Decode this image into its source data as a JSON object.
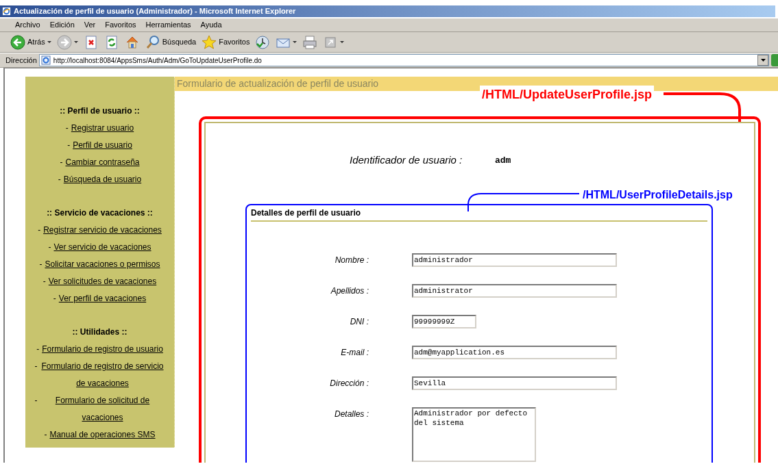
{
  "window": {
    "title": "Actualización de perfil de usuario (Administrador) - Microsoft Internet Explorer"
  },
  "menu": [
    "Archivo",
    "Edición",
    "Ver",
    "Favoritos",
    "Herramientas",
    "Ayuda"
  ],
  "toolbar": [
    {
      "kind": "back",
      "label": "Atrás"
    },
    {
      "kind": "forward"
    },
    {
      "kind": "stop"
    },
    {
      "kind": "refresh"
    },
    {
      "kind": "home"
    },
    {
      "kind": "search",
      "label": "Búsqueda"
    },
    {
      "kind": "favorites",
      "label": "Favoritos"
    },
    {
      "kind": "history"
    },
    {
      "kind": "mail"
    },
    {
      "kind": "print"
    },
    {
      "kind": "edit"
    }
  ],
  "address_bar": {
    "label": "Dirección",
    "url": "http://localhost:8084/AppsSms/Auth/Adm/GoToUpdateUserProfile.do"
  },
  "sidebar": {
    "sections": [
      {
        "heading": ":: Perfil de usuario ::",
        "links": [
          {
            "marker": "-",
            "label": "Registrar usuario"
          },
          {
            "marker": "-",
            "label": "Perfil de usuario"
          },
          {
            "marker": "-",
            "label": "Cambiar contraseña"
          },
          {
            "marker": "-",
            "label": "Búsqueda de usuario"
          }
        ]
      },
      {
        "heading": ":: Servicio de vacaciones ::",
        "links": [
          {
            "marker": "-",
            "label": "Registrar servicio de vacaciones"
          },
          {
            "marker": "-",
            "label": "Ver servicio de vacaciones"
          },
          {
            "marker": "-",
            "label": "Solicitar vacaciones o permisos"
          },
          {
            "marker": "-",
            "label": "Ver solicitudes de vacaciones"
          },
          {
            "marker": "-",
            "label": "Ver perfil de vacaciones"
          }
        ]
      },
      {
        "heading": ":: Utilidades ::",
        "links": [
          {
            "marker": "-",
            "label": "Formulario de registro de usuario"
          },
          {
            "marker": "-",
            "label": "Formulario de registro de servicio de vacaciones"
          },
          {
            "marker": "-",
            "label": "Formulario de solicitud de vacaciones"
          },
          {
            "marker": "-",
            "label": "Manual de operaciones SMS"
          }
        ]
      }
    ]
  },
  "page_header": "Formulario de actualización de perfil de usuario",
  "annotations": [
    "/HTML/UpdateUserProfile.jsp",
    "/HTML/UserProfileDetails.jsp"
  ],
  "user_id": {
    "label": "Identificador de usuario :",
    "value": "adm"
  },
  "details": {
    "title": "Detalles de perfil de usuario",
    "fields": [
      {
        "kind": "input",
        "label": "Nombre :",
        "value": "administrador"
      },
      {
        "kind": "input",
        "label": "Apellidos :",
        "value": "administrator"
      },
      {
        "kind": "short_input",
        "label": "DNI :",
        "value": "99999999Z"
      },
      {
        "kind": "input",
        "label": "E-mail :",
        "value": "adm@myapplication.es"
      },
      {
        "kind": "input",
        "label": "Dirección :",
        "value": "Sevilla"
      },
      {
        "kind": "textarea",
        "label": "Detalles :",
        "value": "Administrador por defecto del sistema"
      }
    ]
  }
}
